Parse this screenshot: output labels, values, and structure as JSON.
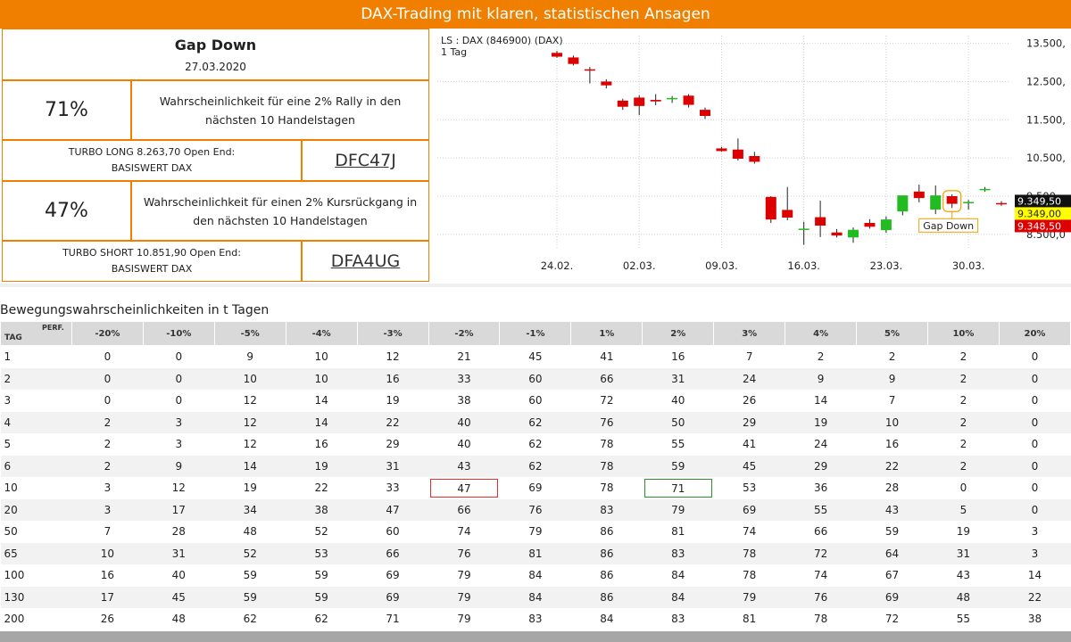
{
  "header": {
    "title": "DAX-Trading mit klaren, statistischen Ansagen"
  },
  "info": {
    "gap_title": "Gap Down",
    "date": "27.03.2020",
    "rally_pct": "71%",
    "rally_text": "Wahrscheinlichkeit für eine 2% Rally in den nächsten 10 Handelstagen",
    "long_product": "TURBO LONG 8.263,70 Open End:",
    "long_base": "BASISWERT DAX",
    "long_wkn": "DFC47J",
    "drop_pct": "47%",
    "drop_text": "Wahrscheinlichkeit für einen 2% Kursrückgang in den nächsten 10 Handelstagen",
    "short_product": "TURBO SHORT 10.851,90 Open End:",
    "short_base": "BASISWERT DAX",
    "short_wkn": "DFA4UG"
  },
  "chart_data": {
    "type": "candlestick",
    "legend_text": "LS : DAX (846900) (DAX)",
    "interval": "1 Tag",
    "ylim": [
      8100,
      13700
    ],
    "y_ticks": [
      8500,
      9500,
      10500,
      11500,
      12500,
      13500
    ],
    "y_tick_labels": [
      "8.500,0",
      "9.500,",
      "10.500,",
      "11.500,",
      "12.500,",
      "13.500,"
    ],
    "x_tick_labels": [
      {
        "label": "24.02.",
        "index": 0
      },
      {
        "label": "02.03.",
        "index": 5
      },
      {
        "label": "09.03.",
        "index": 10
      },
      {
        "label": "16.03.",
        "index": 15
      },
      {
        "label": "23.03.",
        "index": 20
      },
      {
        "label": "30.03.",
        "index": 25
      }
    ],
    "candles": [
      {
        "o": 13250,
        "h": 13300,
        "l": 13120,
        "c": 13150
      },
      {
        "o": 13130,
        "h": 13180,
        "l": 12920,
        "c": 12960
      },
      {
        "o": 12820,
        "h": 12880,
        "l": 12450,
        "c": 12800
      },
      {
        "o": 12500,
        "h": 12560,
        "l": 12320,
        "c": 12400
      },
      {
        "o": 12000,
        "h": 12050,
        "l": 11760,
        "c": 11840
      },
      {
        "o": 12080,
        "h": 12140,
        "l": 11620,
        "c": 11860
      },
      {
        "o": 12020,
        "h": 12170,
        "l": 11880,
        "c": 11980
      },
      {
        "o": 12040,
        "h": 12120,
        "l": 11940,
        "c": 12070
      },
      {
        "o": 12130,
        "h": 12170,
        "l": 11820,
        "c": 11890
      },
      {
        "o": 11760,
        "h": 11820,
        "l": 11520,
        "c": 11600
      },
      {
        "o": 10750,
        "h": 10790,
        "l": 10660,
        "c": 10680
      },
      {
        "o": 10720,
        "h": 11010,
        "l": 10430,
        "c": 10480
      },
      {
        "o": 10550,
        "h": 10660,
        "l": 10350,
        "c": 10400
      },
      {
        "o": 9480,
        "h": 9500,
        "l": 8800,
        "c": 8890
      },
      {
        "o": 9140,
        "h": 9740,
        "l": 8870,
        "c": 8940
      },
      {
        "o": 8640,
        "h": 8830,
        "l": 8230,
        "c": 8650
      },
      {
        "o": 8950,
        "h": 9380,
        "l": 8430,
        "c": 8730
      },
      {
        "o": 8550,
        "h": 8640,
        "l": 8420,
        "c": 8470
      },
      {
        "o": 8420,
        "h": 8680,
        "l": 8280,
        "c": 8620
      },
      {
        "o": 8800,
        "h": 8900,
        "l": 8650,
        "c": 8700
      },
      {
        "o": 8610,
        "h": 8970,
        "l": 8540,
        "c": 8890
      },
      {
        "o": 9100,
        "h": 9470,
        "l": 9000,
        "c": 9520
      },
      {
        "o": 9620,
        "h": 9800,
        "l": 9340,
        "c": 9450
      },
      {
        "o": 9150,
        "h": 9780,
        "l": 9030,
        "c": 9520
      },
      {
        "o": 9500,
        "h": 9550,
        "l": 9190,
        "c": 9300
      },
      {
        "o": 9349,
        "h": 9400,
        "l": 9150,
        "c": 9349
      },
      {
        "o": 9690,
        "h": 9740,
        "l": 9620,
        "c": 9690
      },
      {
        "o": 9320,
        "h": 9370,
        "l": 9250,
        "c": 9290
      }
    ],
    "callout_index": 24,
    "callout_label": "Gap Down",
    "price_labels": [
      {
        "text": "9.349,50",
        "value": 9349.5,
        "bg": "#111111",
        "fg": "#ffffff"
      },
      {
        "text": "9.349,00",
        "value": 9349.0,
        "bg": "#ffff00",
        "fg": "#222222"
      },
      {
        "text": "9.348,50",
        "value": 9348.5,
        "bg": "#dd0000",
        "fg": "#ffffff"
      }
    ],
    "colors": {
      "up": "#22bb22",
      "down": "#dd0000",
      "grid": "#cfcfcf"
    }
  },
  "table": {
    "title": "Bewegungswahrscheinlichkeiten in t Tagen",
    "header_perf": "PERF.",
    "header_tag": "TAG",
    "columns": [
      "-20%",
      "-10%",
      "-5%",
      "-4%",
      "-3%",
      "-2%",
      "-1%",
      "1%",
      "2%",
      "3%",
      "4%",
      "5%",
      "10%",
      "20%"
    ],
    "rows": [
      {
        "tag": "1",
        "values": [
          "0",
          "0",
          "9",
          "10",
          "12",
          "21",
          "45",
          "41",
          "16",
          "7",
          "2",
          "2",
          "2",
          "0"
        ]
      },
      {
        "tag": "2",
        "values": [
          "0",
          "0",
          "10",
          "10",
          "16",
          "33",
          "60",
          "66",
          "31",
          "24",
          "9",
          "9",
          "2",
          "0"
        ]
      },
      {
        "tag": "3",
        "values": [
          "0",
          "0",
          "12",
          "14",
          "19",
          "38",
          "60",
          "72",
          "40",
          "26",
          "14",
          "7",
          "2",
          "0"
        ]
      },
      {
        "tag": "4",
        "values": [
          "2",
          "3",
          "12",
          "14",
          "22",
          "40",
          "62",
          "76",
          "50",
          "29",
          "19",
          "10",
          "2",
          "0"
        ]
      },
      {
        "tag": "5",
        "values": [
          "2",
          "3",
          "12",
          "16",
          "29",
          "40",
          "62",
          "78",
          "55",
          "41",
          "24",
          "16",
          "2",
          "0"
        ]
      },
      {
        "tag": "6",
        "values": [
          "2",
          "9",
          "14",
          "19",
          "31",
          "43",
          "62",
          "78",
          "59",
          "45",
          "29",
          "22",
          "2",
          "0"
        ]
      },
      {
        "tag": "10",
        "values": [
          "3",
          "12",
          "19",
          "22",
          "33",
          "47",
          "69",
          "78",
          "71",
          "53",
          "36",
          "28",
          "0",
          "0"
        ]
      },
      {
        "tag": "20",
        "values": [
          "3",
          "17",
          "34",
          "38",
          "47",
          "66",
          "76",
          "83",
          "79",
          "69",
          "55",
          "43",
          "5",
          "0"
        ]
      },
      {
        "tag": "50",
        "values": [
          "7",
          "28",
          "48",
          "52",
          "60",
          "74",
          "79",
          "86",
          "81",
          "74",
          "66",
          "59",
          "19",
          "3"
        ]
      },
      {
        "tag": "65",
        "values": [
          "10",
          "31",
          "52",
          "53",
          "66",
          "76",
          "81",
          "86",
          "83",
          "78",
          "72",
          "64",
          "31",
          "3"
        ]
      },
      {
        "tag": "100",
        "values": [
          "16",
          "40",
          "59",
          "59",
          "69",
          "79",
          "84",
          "86",
          "84",
          "78",
          "74",
          "67",
          "43",
          "14"
        ]
      },
      {
        "tag": "130",
        "values": [
          "17",
          "45",
          "59",
          "59",
          "69",
          "79",
          "84",
          "86",
          "84",
          "79",
          "76",
          "69",
          "48",
          "22"
        ]
      },
      {
        "tag": "200",
        "values": [
          "26",
          "48",
          "62",
          "62",
          "71",
          "79",
          "83",
          "84",
          "83",
          "81",
          "78",
          "72",
          "55",
          "38"
        ]
      }
    ],
    "highlight_red": {
      "row": 6,
      "col": 5
    },
    "highlight_green": {
      "row": 6,
      "col": 8
    }
  }
}
